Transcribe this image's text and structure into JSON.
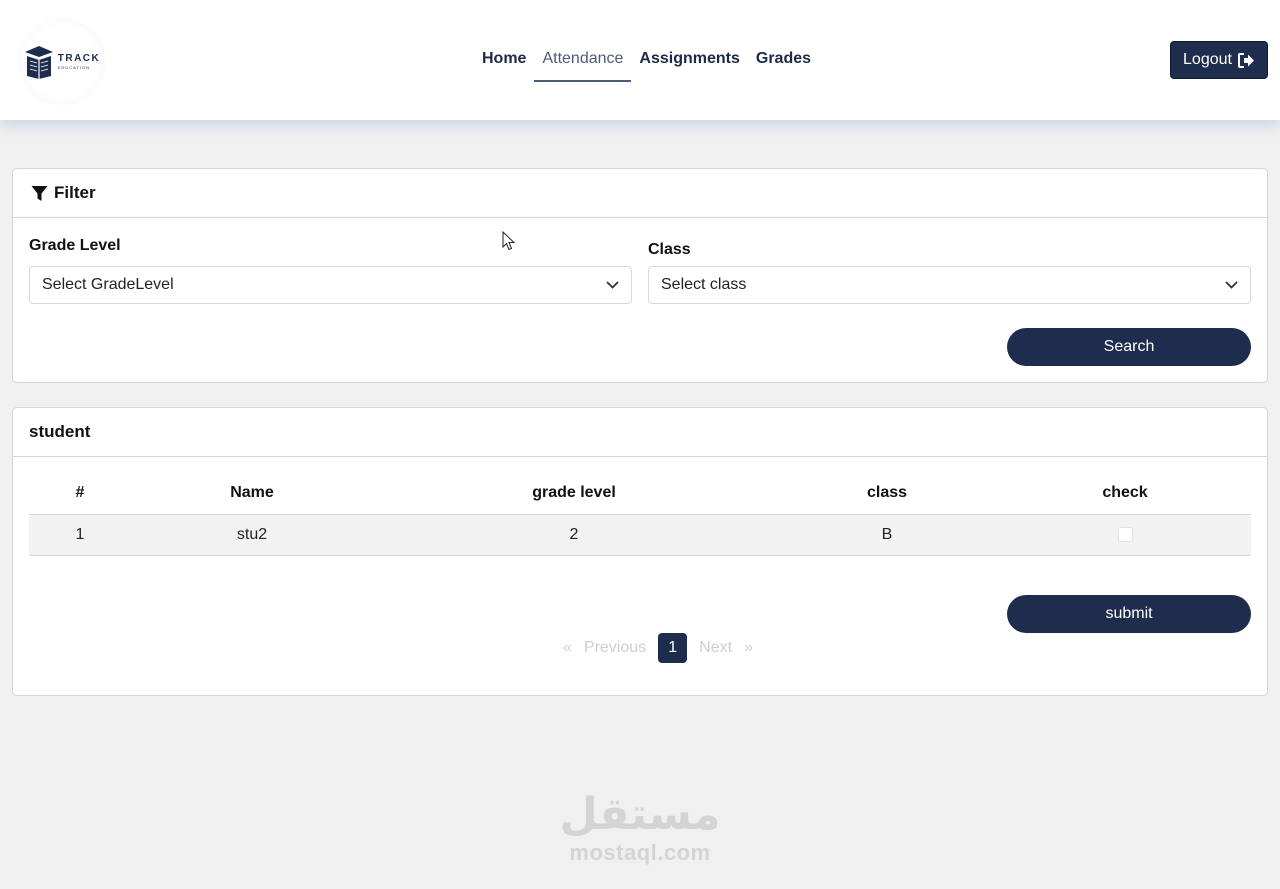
{
  "header": {
    "logo": {
      "title": "TRACK",
      "subtitle": "EDUCATION"
    },
    "nav": [
      {
        "label": "Home",
        "active": false
      },
      {
        "label": "Attendance",
        "active": true
      },
      {
        "label": "Assignments",
        "active": false
      },
      {
        "label": "Grades",
        "active": false
      }
    ],
    "logout_label": "Logout",
    "logout_icon": "sign-out-icon"
  },
  "filter": {
    "title": "Filter",
    "icon": "filter-icon",
    "grade_label": "Grade Level",
    "grade_select": "Select GradeLevel",
    "class_label": "Class",
    "class_select": "Select class",
    "search_label": "Search"
  },
  "students": {
    "title": "student",
    "columns": [
      "#",
      "Name",
      "grade level",
      "class",
      "check"
    ],
    "rows": [
      {
        "num": "1",
        "name": "stu2",
        "grade": "2",
        "class": "B",
        "checked": false
      }
    ],
    "submit_label": "submit",
    "pagination": {
      "first": "«",
      "previous": "Previous",
      "current": "1",
      "next": "Next",
      "last": "»"
    }
  },
  "watermark": {
    "arabic": "مستقل",
    "latin": "mostaql.com"
  },
  "colors": {
    "primary": "#1e2d4d",
    "background": "#f0f0f0"
  }
}
